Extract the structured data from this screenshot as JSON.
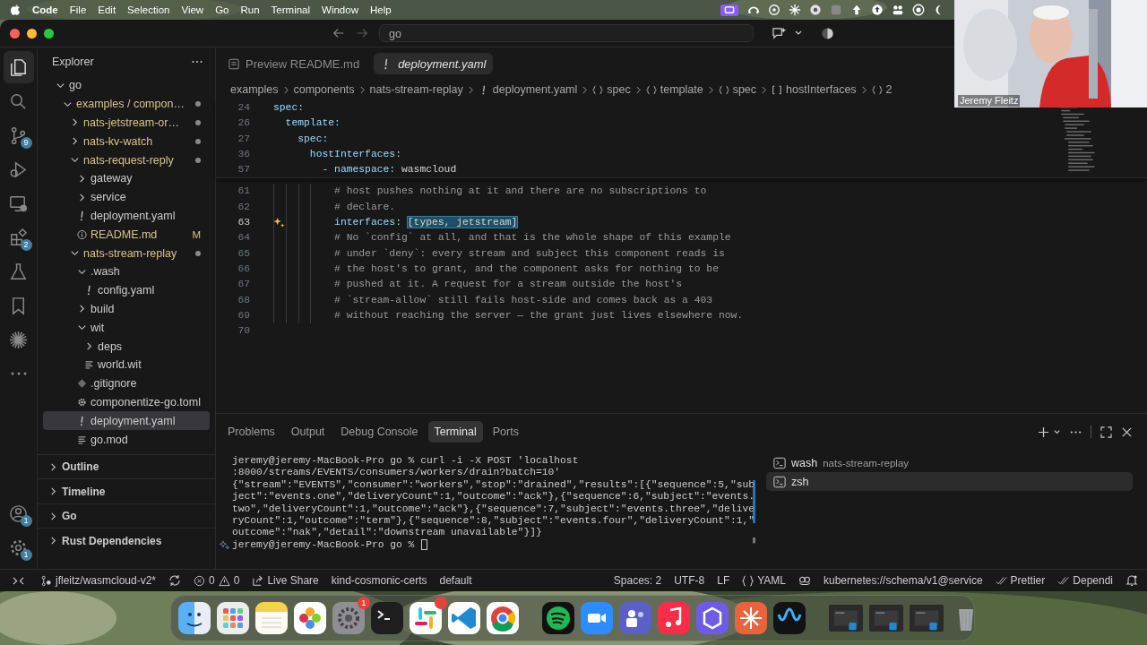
{
  "menubar": {
    "app": "Code",
    "menus": [
      "File",
      "Edit",
      "Selection",
      "View",
      "Go",
      "Run",
      "Terminal",
      "Window",
      "Help"
    ]
  },
  "titlebar": {
    "search": "go"
  },
  "activity_bar": {
    "top": [
      {
        "kind": "explorer",
        "selected": true
      },
      {
        "kind": "search",
        "selected": false
      },
      {
        "kind": "source-control",
        "selected": false,
        "badge": "9"
      },
      {
        "kind": "run-debug",
        "selected": false
      },
      {
        "kind": "remote",
        "selected": false
      },
      {
        "kind": "extensions",
        "selected": false,
        "badge": "2"
      },
      {
        "kind": "testing",
        "selected": false
      },
      {
        "kind": "bookmarks",
        "selected": false
      },
      {
        "kind": "burst",
        "selected": false
      },
      {
        "kind": "more",
        "selected": false
      }
    ],
    "bottom": [
      {
        "kind": "accounts",
        "badge": "1"
      },
      {
        "kind": "settings",
        "badge": "1"
      }
    ]
  },
  "sidebar": {
    "title": "Explorer",
    "tree": [
      {
        "label": "go",
        "kind": "folder",
        "expanded": true,
        "selected": false,
        "modified": false,
        "children": [
          {
            "label": "examples / compon…",
            "kind": "folder",
            "expanded": true,
            "selected": false,
            "modified": true,
            "children": [
              {
                "label": "nats-jetstream-or…",
                "kind": "folder",
                "expanded": false,
                "selected": false,
                "modified": true
              },
              {
                "label": "nats-kv-watch",
                "kind": "folder",
                "expanded": false,
                "selected": false,
                "modified": true
              },
              {
                "label": "nats-request-reply",
                "kind": "folder",
                "expanded": true,
                "selected": false,
                "modified": true,
                "children": [
                  {
                    "label": "gateway",
                    "kind": "folder",
                    "expanded": false,
                    "selected": false,
                    "modified": false
                  },
                  {
                    "label": "service",
                    "kind": "folder",
                    "expanded": false,
                    "selected": false,
                    "modified": false
                  },
                  {
                    "label": "deployment.yaml",
                    "kind": "yaml",
                    "selected": false,
                    "modified": false
                  },
                  {
                    "label": "README.md",
                    "kind": "info",
                    "selected": false,
                    "modified": true,
                    "badge": "M"
                  }
                ]
              },
              {
                "label": "nats-stream-replay",
                "kind": "folder",
                "expanded": true,
                "selected": false,
                "modified": true,
                "children": [
                  {
                    "label": ".wash",
                    "kind": "folder",
                    "expanded": true,
                    "selected": false,
                    "modified": false,
                    "children": [
                      {
                        "label": "config.yaml",
                        "kind": "yaml",
                        "selected": false,
                        "modified": false
                      }
                    ]
                  },
                  {
                    "label": "build",
                    "kind": "folder",
                    "expanded": false,
                    "selected": false,
                    "modified": false
                  },
                  {
                    "label": "wit",
                    "kind": "folder",
                    "expanded": true,
                    "selected": false,
                    "modified": false,
                    "children": [
                      {
                        "label": "deps",
                        "kind": "folder",
                        "expanded": false,
                        "selected": false,
                        "modified": false
                      },
                      {
                        "label": "world.wit",
                        "kind": "text",
                        "selected": false,
                        "modified": false
                      }
                    ]
                  },
                  {
                    "label": ".gitignore",
                    "kind": "git",
                    "selected": false,
                    "modified": false
                  },
                  {
                    "label": "componentize-go.toml",
                    "kind": "config",
                    "selected": false,
                    "modified": false
                  },
                  {
                    "label": "deployment.yaml",
                    "kind": "yaml",
                    "selected": true,
                    "modified": false
                  },
                  {
                    "label": "go.mod",
                    "kind": "text",
                    "selected": false,
                    "modified": false
                  }
                ]
              }
            ]
          }
        ]
      }
    ],
    "sections": [
      {
        "label": "Outline",
        "expanded": false
      },
      {
        "label": "Timeline",
        "expanded": false
      },
      {
        "label": "Go",
        "expanded": false
      },
      {
        "label": "Rust Dependencies",
        "expanded": false
      }
    ]
  },
  "editor": {
    "tabs": [
      {
        "label": "Preview README.md",
        "kind": "preview",
        "selected": false,
        "preview_mode": false
      },
      {
        "label": "deployment.yaml",
        "kind": "yaml",
        "selected": true,
        "preview_mode": true
      }
    ],
    "breadcrumbs": [
      {
        "label": "examples",
        "kind": "folder"
      },
      {
        "label": "components",
        "kind": "folder"
      },
      {
        "label": "nats-stream-replay",
        "kind": "folder"
      },
      {
        "label": "deployment.yaml",
        "kind": "yaml"
      },
      {
        "label": "spec",
        "kind": "object"
      },
      {
        "label": "template",
        "kind": "object"
      },
      {
        "label": "spec",
        "kind": "object"
      },
      {
        "label": "hostInterfaces",
        "kind": "array"
      },
      {
        "label": "2",
        "kind": "object"
      }
    ],
    "sticky_lines": [
      {
        "number": "24",
        "key": "spec:"
      },
      {
        "number": "26",
        "key": "  template:"
      },
      {
        "number": "27",
        "key": "    spec:"
      },
      {
        "number": "36",
        "key": "      hostInterfaces:"
      },
      {
        "number": "57",
        "key": "        - namespace:",
        "value": "wasmcloud"
      }
    ],
    "lines": [
      {
        "number": "61",
        "kind": "comment",
        "text": "          # host pushes nothing at it and there are no subscriptions to",
        "current": false,
        "highlighted": false
      },
      {
        "number": "62",
        "kind": "comment",
        "text": "          # declare.",
        "current": false,
        "highlighted": false
      },
      {
        "number": "63",
        "kind": "pair",
        "key": "          interfaces:",
        "value": "[types, jetstream]",
        "current": true,
        "highlighted": true
      },
      {
        "number": "64",
        "kind": "comment",
        "text": "          # No `config` at all, and that is the whole shape of this example",
        "current": false,
        "highlighted": false
      },
      {
        "number": "65",
        "kind": "comment",
        "text": "          # under `deny`: every stream and subject this component reads is",
        "current": false,
        "highlighted": false
      },
      {
        "number": "66",
        "kind": "comment",
        "text": "          # the host's to grant, and the component asks for nothing to be",
        "current": false,
        "highlighted": false
      },
      {
        "number": "67",
        "kind": "comment",
        "text": "          # pushed at it. A request for a stream outside the host's",
        "current": false,
        "highlighted": false
      },
      {
        "number": "68",
        "kind": "comment",
        "text": "          # `stream-allow` still fails host-side and comes back as a 403",
        "current": false,
        "highlighted": false
      },
      {
        "number": "69",
        "kind": "comment",
        "text": "          # without reaching the server — the grant just lives elsewhere now.",
        "current": false,
        "highlighted": false
      },
      {
        "number": "70",
        "kind": "blank",
        "current": false,
        "highlighted": false
      }
    ]
  },
  "panel": {
    "tabs": [
      {
        "label": "Problems",
        "selected": false
      },
      {
        "label": "Output",
        "selected": false
      },
      {
        "label": "Debug Console",
        "selected": false
      },
      {
        "label": "Terminal",
        "selected": true
      },
      {
        "label": "Ports",
        "selected": false
      }
    ],
    "terminal": [
      {
        "kind": "command",
        "text": "jeremy@jeremy-MacBook-Pro go % curl -i -X POST 'localhost"
      },
      {
        "kind": "output",
        "text": ":8000/streams/EVENTS/consumers/workers/drain?batch=10'"
      },
      {
        "kind": "output",
        "text": "{\"stream\":\"EVENTS\",\"consumer\":\"workers\",\"stop\":\"drained\",\"results\":[{\"sequence\":5,\"sub"
      },
      {
        "kind": "output",
        "text": "ject\":\"events.one\",\"deliveryCount\":1,\"outcome\":\"ack\"},{\"sequence\":6,\"subject\":\"events."
      },
      {
        "kind": "output",
        "text": "two\",\"deliveryCount\":1,\"outcome\":\"ack\"},{\"sequence\":7,\"subject\":\"events.three\",\"delive"
      },
      {
        "kind": "output",
        "text": "ryCount\":1,\"outcome\":\"term\"},{\"sequence\":8,\"subject\":\"events.four\",\"deliveryCount\":1,\""
      },
      {
        "kind": "output",
        "text": "outcome\":\"nak\",\"detail\":\"downstream unavailable\"}]}"
      },
      {
        "kind": "prompt",
        "text": "jeremy@jeremy-MacBook-Pro go %"
      }
    ],
    "terminals": [
      {
        "name": "wash",
        "detail": "nats-stream-replay",
        "selected": false
      },
      {
        "name": "zsh",
        "selected": true
      }
    ]
  },
  "status_bar": {
    "left": [
      {
        "kind": "remote"
      },
      {
        "kind": "branch",
        "text": "jfleitz/wasmcloud-v2*"
      },
      {
        "kind": "sync"
      },
      {
        "kind": "problems",
        "errors": "0",
        "warnings": "0"
      },
      {
        "kind": "live-share",
        "text": "Live Share"
      },
      {
        "kind": "plain",
        "text": "kind-cosmonic-certs"
      },
      {
        "kind": "plain",
        "text": "default"
      }
    ],
    "right": [
      {
        "kind": "plain",
        "text": "Spaces: 2"
      },
      {
        "kind": "plain",
        "text": "UTF-8"
      },
      {
        "kind": "plain",
        "text": "LF"
      },
      {
        "kind": "language",
        "text": "YAML"
      },
      {
        "kind": "copilot"
      },
      {
        "kind": "plain",
        "text": "kubernetes://schema/v1@service"
      },
      {
        "kind": "check",
        "text": "Prettier"
      },
      {
        "kind": "check",
        "text": "Dependi"
      },
      {
        "kind": "bell"
      }
    ]
  },
  "video_tile": {
    "name": "Jeremy Fleitz"
  },
  "dock": {
    "groups": [
      {
        "items": [
          {
            "kind": "finder",
            "notified": false
          },
          {
            "kind": "launchpad",
            "notified": false
          },
          {
            "kind": "notes",
            "notified": false
          },
          {
            "kind": "photos",
            "notified": false
          },
          {
            "kind": "settings",
            "notified": true,
            "badge": "1"
          },
          {
            "kind": "terminal",
            "notified": false
          },
          {
            "kind": "slack",
            "notified": true
          },
          {
            "kind": "vscode",
            "notified": false
          },
          {
            "kind": "chrome",
            "notified": false
          }
        ]
      },
      {
        "items": [
          {
            "kind": "spotify",
            "notified": false
          },
          {
            "kind": "zoom",
            "notified": false
          },
          {
            "kind": "teams",
            "notified": false
          },
          {
            "kind": "music",
            "notified": false
          },
          {
            "kind": "cube",
            "notified": false
          },
          {
            "kind": "burst",
            "notified": false
          },
          {
            "kind": "webex",
            "notified": false
          }
        ]
      },
      {
        "items": [
          {
            "kind": "window",
            "notified": false
          },
          {
            "kind": "window",
            "notified": false
          },
          {
            "kind": "window",
            "notified": false
          },
          {
            "kind": "trash",
            "notified": false
          }
        ]
      }
    ]
  }
}
